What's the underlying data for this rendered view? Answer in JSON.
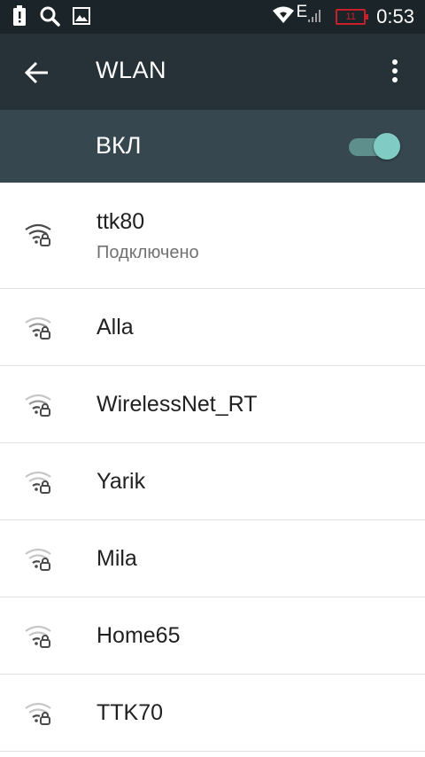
{
  "status_bar": {
    "icons_left": [
      "alert-icon",
      "search-icon",
      "image-icon"
    ],
    "network_type": "E",
    "battery_level": "11",
    "time": "0:53"
  },
  "app_bar": {
    "title": "WLAN"
  },
  "wifi_toggle": {
    "label": "ВКЛ",
    "on": true
  },
  "networks": [
    {
      "ssid": "ttk80",
      "status": "Подключено",
      "locked": true
    },
    {
      "ssid": "Alla",
      "locked": true
    },
    {
      "ssid": "WirelessNet_RT",
      "locked": true
    },
    {
      "ssid": "Yarik",
      "locked": true
    },
    {
      "ssid": "Mila",
      "locked": true
    },
    {
      "ssid": "Home65",
      "locked": true
    },
    {
      "ssid": "TTK70",
      "locked": true
    }
  ],
  "colors": {
    "status_bar_bg": "#1b2428",
    "app_bar_bg": "#263238",
    "toggle_bar_bg": "#37474f",
    "switch_accent": "#80cbc4",
    "battery_warning": "#c8202a"
  }
}
